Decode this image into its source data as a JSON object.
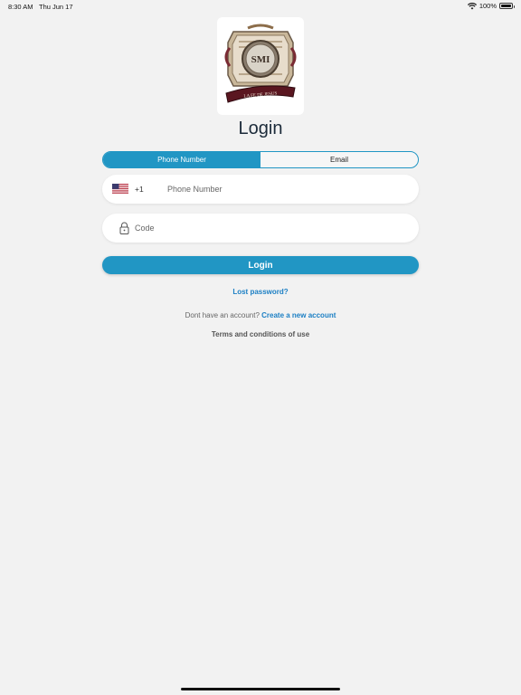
{
  "status_bar": {
    "time": "8:30 AM",
    "date": "Thu Jun 17",
    "battery": "100%"
  },
  "logo": {
    "monogram": "SMI",
    "ribbon_text": "LA FE DE JESUS"
  },
  "title": "Login",
  "tabs": [
    {
      "label": "Phone Number",
      "active": true
    },
    {
      "label": "Email",
      "active": false
    }
  ],
  "phone_field": {
    "country_flag": "us-flag-icon",
    "dial_code": "+1",
    "placeholder": "Phone Number",
    "value": ""
  },
  "code_field": {
    "icon": "lock-icon",
    "placeholder": "Code",
    "value": ""
  },
  "login_button": "Login",
  "lost_password": "Lost password?",
  "account_prompt": "Dont have an account?",
  "create_account": "Create a new account",
  "terms": "Terms and conditions of use",
  "colors": {
    "accent": "#2196c4",
    "link": "#1b7fc4",
    "background": "#f2f2f2"
  }
}
